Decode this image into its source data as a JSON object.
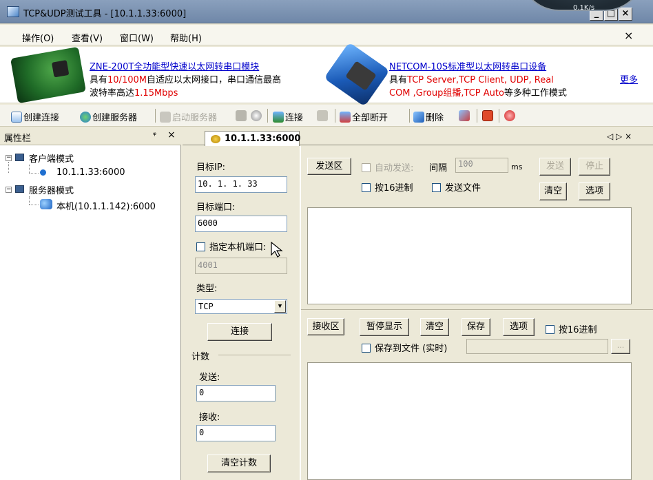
{
  "window": {
    "title": "TCP&UDP测试工具 - [10.1.1.33:6000]",
    "controls": {
      "minimize": "_",
      "maximize": "□",
      "close": "×"
    },
    "overlay_text": "0.1K/s"
  },
  "menu": {
    "items": [
      "操作(O)",
      "查看(V)",
      "窗口(W)",
      "帮助(H)"
    ],
    "close": "×"
  },
  "banner": {
    "ad1": {
      "link": "ZNE-200T全功能型快速以太网转串口模块",
      "line2_pre": "具有",
      "line2_red": "10/100M",
      "line2_post": "自适应以太网接口，串口通信最高",
      "line3_pre": "波特率高达",
      "line3_red": "1.15Mbps"
    },
    "ad2": {
      "link": "NETCOM-10S标准型以太网转串口设备",
      "line2_pre": "具有",
      "line2_red": "TCP Server,TCP Client, UDP, Real",
      "line3_red": "COM ,Group组播,TCP Auto",
      "line3_post": "等多种工作模式"
    },
    "more": "更多"
  },
  "toolbar": {
    "create_conn": "创建连接",
    "create_server": "创建服务器",
    "start_server": "启动服务器",
    "connect": "连接",
    "disconnect_all": "全部断开",
    "delete": "删除"
  },
  "propbar": {
    "title": "属性栏",
    "pin": "ᵠ",
    "close": "×",
    "tree": {
      "client_mode": "客户端模式",
      "client_item": "10.1.1.33:6000",
      "server_mode": "服务器模式",
      "server_item": "本机(10.1.1.142):6000"
    }
  },
  "tab": {
    "label": "10.1.1.33:6000",
    "nav": "◁ ▷ ×"
  },
  "form": {
    "target_ip_label": "目标IP:",
    "target_ip": "10. 1. 1. 33",
    "target_port_label": "目标端口:",
    "target_port": "6000",
    "local_port_label": "指定本机端口:",
    "local_port": "4001",
    "type_label": "类型:",
    "type_value": "TCP",
    "connect_button": "连接",
    "count_label": "计数",
    "send_label": "发送:",
    "send_count": "0",
    "recv_label": "接收:",
    "recv_count": "0",
    "clear_count_button": "清空计数"
  },
  "send": {
    "title": "发送区",
    "auto_send": "自动发送:",
    "interval_label": "间隔",
    "interval_value": "100",
    "unit": "ms",
    "send_button": "发送",
    "stop_button": "停止",
    "hex_label": "按16进制",
    "send_file_label": "发送文件",
    "clear_button": "清空",
    "options_button": "选项"
  },
  "recv": {
    "title": "接收区",
    "pause_button": "暂停显示",
    "clear_button": "清空",
    "save_button": "保存",
    "options_button": "选项",
    "hex_label": "按16进制",
    "save_file_label": "保存到文件 (实时)",
    "browse_button": "..."
  }
}
